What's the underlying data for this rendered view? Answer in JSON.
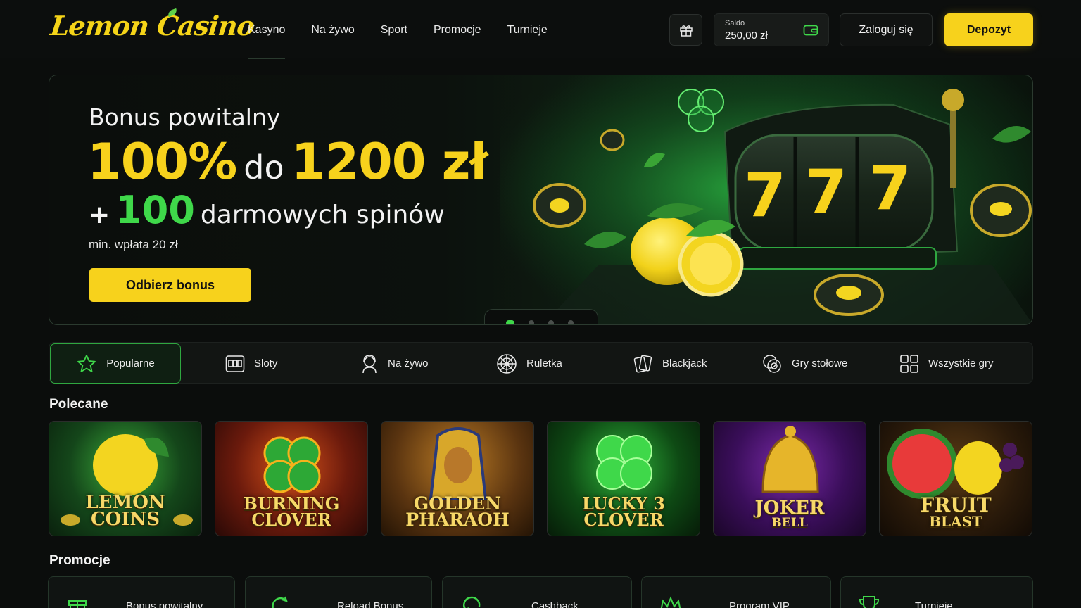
{
  "header": {
    "logo": "Lemon Casino",
    "nav": [
      "Kasyno",
      "Na żywo",
      "Sport",
      "Promocje",
      "Turnieje"
    ],
    "balance_label": "Saldo",
    "balance_value": "250,00 zł",
    "login": "Zaloguj się",
    "deposit": "Depozyt"
  },
  "hero": {
    "subtitle": "Bonus powitalny",
    "percent": "100%",
    "to": "do",
    "amount": "1200 zł",
    "plus": "+",
    "spins_count": "100",
    "spins_text": "darmowych spinów",
    "min": "min. wpłata 20 zł",
    "cta": "Odbierz bonus",
    "slides": 4,
    "active_slide": 1,
    "slot_text": "777"
  },
  "categories": [
    {
      "label": "Popularne",
      "icon": "star-icon"
    },
    {
      "label": "Sloty",
      "icon": "slot-machine-icon"
    },
    {
      "label": "Na żywo",
      "icon": "live-dealer-icon"
    },
    {
      "label": "Ruletka",
      "icon": "roulette-icon"
    },
    {
      "label": "Blackjack",
      "icon": "cards-icon"
    },
    {
      "label": "Gry stołowe",
      "icon": "chips-icon"
    },
    {
      "label": "Wszystkie gry",
      "icon": "grid-icon"
    }
  ],
  "featured": {
    "title": "Polecane",
    "games": [
      {
        "line1": "LEMON",
        "line2": "COINS"
      },
      {
        "line1": "BURNING",
        "line2": "CLOVER"
      },
      {
        "line1": "GOLDEN",
        "line2": "PHARAOH"
      },
      {
        "line1": "LUCKY 3",
        "line2": "CLOVER"
      },
      {
        "line1": "JOKER",
        "line2": "BELL"
      },
      {
        "line1": "FRUIT",
        "line2": "BLAST"
      }
    ]
  },
  "promotions": {
    "title": "Promocje",
    "items": [
      "Bonus powitalny",
      "Reload Bonus",
      "Cashback",
      "Program VIP",
      "Turnieje"
    ]
  },
  "colors": {
    "accent_yellow": "#f7d21c",
    "accent_green": "#3fd84a",
    "background": "#0b0d0c"
  }
}
